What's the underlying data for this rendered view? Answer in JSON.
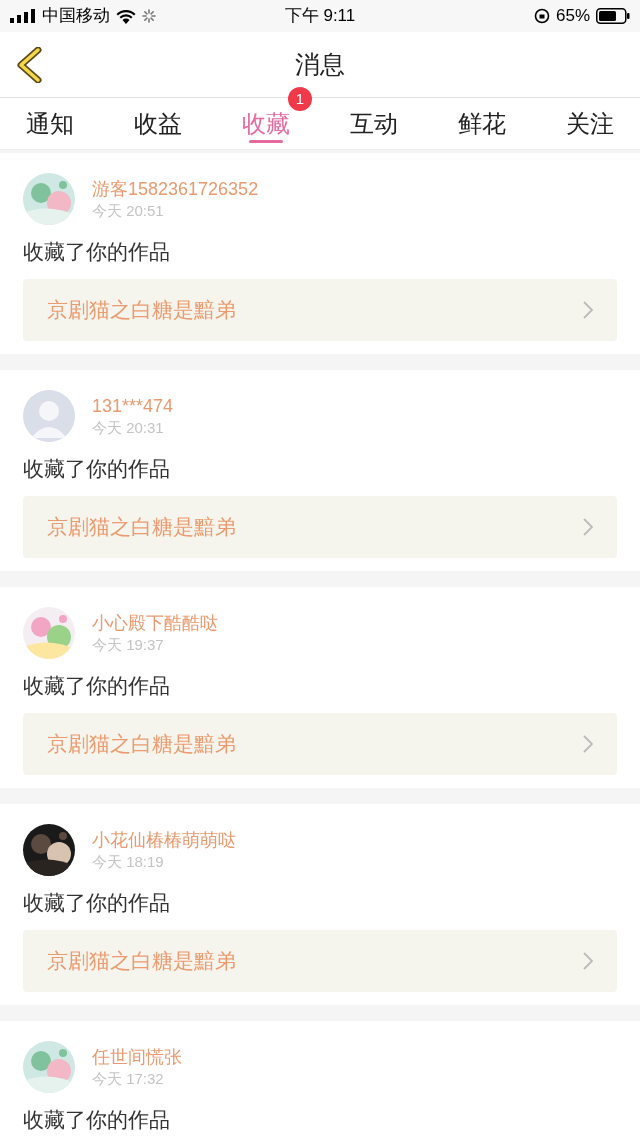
{
  "status_bar": {
    "carrier": "中国移动",
    "time": "下午 9:11",
    "battery": "65%"
  },
  "header": {
    "title": "消息"
  },
  "tabs": [
    {
      "label": "通知",
      "selected": false
    },
    {
      "label": "收益",
      "selected": false
    },
    {
      "label": "收藏",
      "selected": true,
      "badge": "1"
    },
    {
      "label": "互动",
      "selected": false
    },
    {
      "label": "鲜花",
      "selected": false
    },
    {
      "label": "关注",
      "selected": false
    }
  ],
  "messages": [
    {
      "name": "游客1582361726352",
      "time": "今天 20:51",
      "action": "收藏了你的作品",
      "work": "京剧猫之白糖是黯弟"
    },
    {
      "avatar": {
        "kind": "default"
      },
      "name": "131***474",
      "time": "今天 20:31",
      "action": "收藏了你的作品",
      "work": "京剧猫之白糖是黯弟"
    },
    {
      "name": "小心殿下酷酷哒",
      "time": "今天 19:37",
      "action": "收藏了你的作品",
      "work": "京剧猫之白糖是黯弟"
    },
    {
      "name": "小花仙椿椿萌萌哒",
      "time": "今天 18:19",
      "action": "收藏了你的作品",
      "work": "京剧猫之白糖是黯弟"
    },
    {
      "name": "任世间慌张",
      "time": "今天 17:32",
      "action": "收藏了你的作品"
    }
  ]
}
